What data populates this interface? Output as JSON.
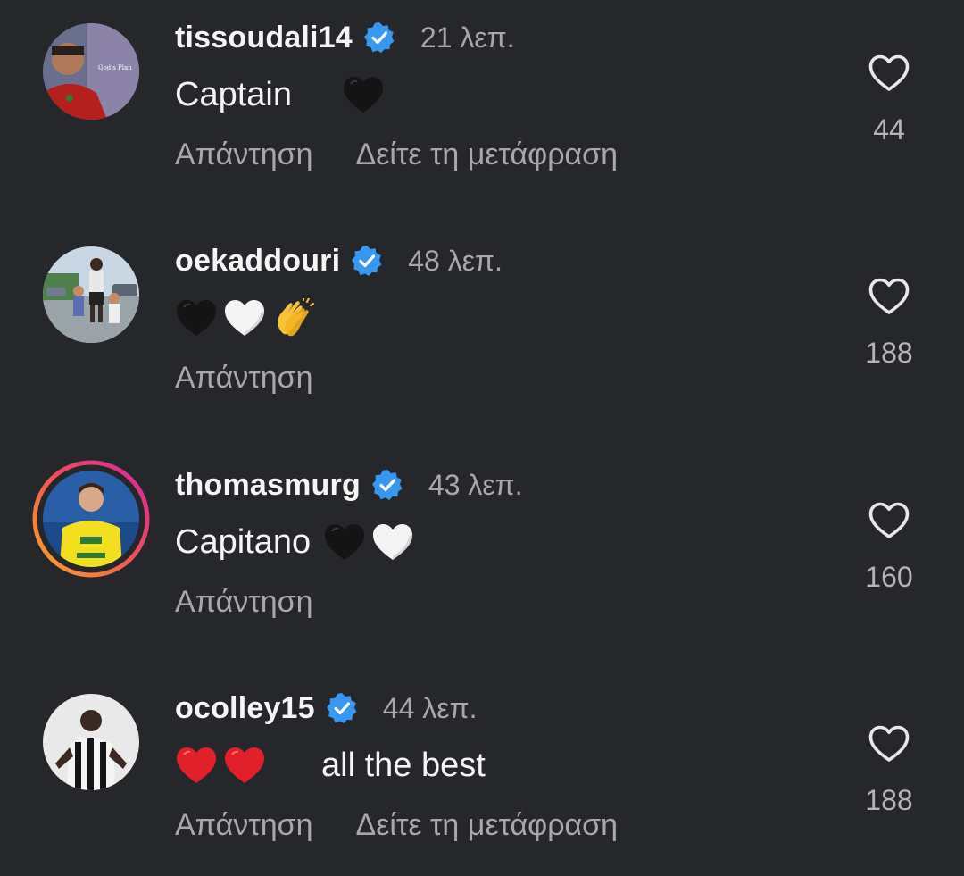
{
  "comments": [
    {
      "username": "tissoudali14",
      "time": "21 λεπ.",
      "text": "Captain",
      "emojis": [
        "black-heart"
      ],
      "reply_label": "Απάντηση",
      "translate_label": "Δείτε τη μετάφραση",
      "likes": "44"
    },
    {
      "username": "oekaddouri",
      "time": "48 λεπ.",
      "text": "",
      "emojis": [
        "black-heart",
        "white-heart",
        "clapping-hands"
      ],
      "reply_label": "Απάντηση",
      "translate_label": "",
      "likes": "188"
    },
    {
      "username": "thomasmurg",
      "time": "43 λεπ.",
      "text": "Capitano",
      "emojis": [
        "black-heart",
        "white-heart"
      ],
      "reply_label": "Απάντηση",
      "translate_label": "",
      "likes": "160"
    },
    {
      "username": "ocolley15",
      "time": "44 λεπ.",
      "text": "all the best",
      "emojis": [
        "red-heart",
        "red-heart"
      ],
      "reply_label": "Απάντηση",
      "translate_label": "Δείτε τη μετάφραση",
      "likes": "188"
    }
  ],
  "colors": {
    "background": "#25272b",
    "verified_badge": "#3897f0",
    "secondary_text": "#a8a8a8",
    "story_ring_start": "#f9a825",
    "story_ring_end": "#d6249f"
  },
  "icons": {
    "like": "heart-outline-icon",
    "verified": "verified-badge-icon"
  }
}
